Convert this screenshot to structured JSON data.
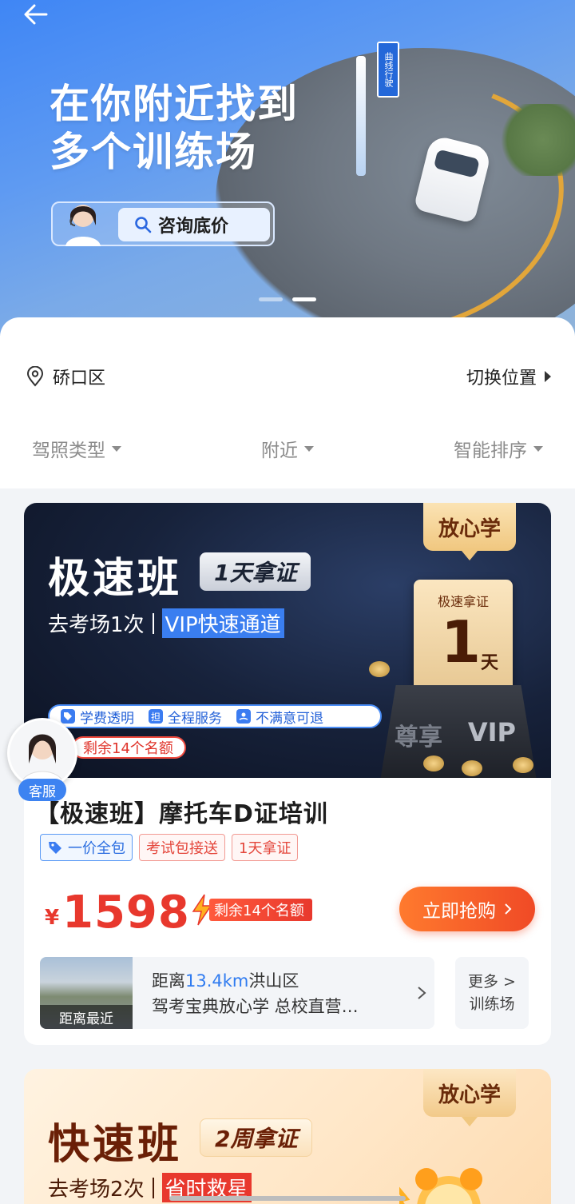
{
  "hero": {
    "title_line1": "在你附近找到",
    "title_line2": "多个训练场",
    "consult_label": "咨询底价",
    "road_sign_text": "曲线行驶",
    "slide_count": 2,
    "active_slide": 2
  },
  "location": {
    "district": "硚口区",
    "switch_label": "切换位置"
  },
  "filters": [
    {
      "label": "驾照类型"
    },
    {
      "label": "附近"
    },
    {
      "label": "智能排序"
    }
  ],
  "card1": {
    "badge": "放心学",
    "promo_title": "极速班",
    "promo_tag": "1天拿证",
    "promo_sub_left": "去考场1次",
    "promo_sub_right": "VIP快速通道",
    "ticket_top": "极速拿证",
    "ticket_num": "1",
    "ticket_unit": "天",
    "box_left": "尊享",
    "box_right": "VIP",
    "features": [
      "学费透明",
      "全程服务",
      "不满意可退"
    ],
    "feature_icon_text": "担",
    "remain": "剩余14个名额",
    "cs_label": "客服",
    "course_title": "【极速班】摩托车D证培训",
    "tags": [
      {
        "label": "一价全包",
        "style": "blue",
        "icon": "tag-icon"
      },
      {
        "label": "考试包接送",
        "style": "red"
      },
      {
        "label": "1天拿证",
        "style": "red"
      }
    ],
    "currency": "¥",
    "price": "1598",
    "flash_text": "剩余14个名额",
    "buy_label": "立即抢购",
    "field": {
      "thumb_label": "距离最近",
      "distance_prefix": "距离",
      "distance": "13.4km",
      "area": "洪山区",
      "name": "驾考宝典放心学 总校直营…"
    },
    "more_line1": "更多 >",
    "more_line2": "训练场"
  },
  "card2": {
    "badge": "放心学",
    "title": "快速班",
    "tag": "2周拿证",
    "sub_left": "去考场2次",
    "sub_right": "省时救星"
  },
  "colors": {
    "primary_blue": "#3f86f5",
    "price_red": "#e8382d",
    "buy_orange": "#ff7a2e"
  }
}
